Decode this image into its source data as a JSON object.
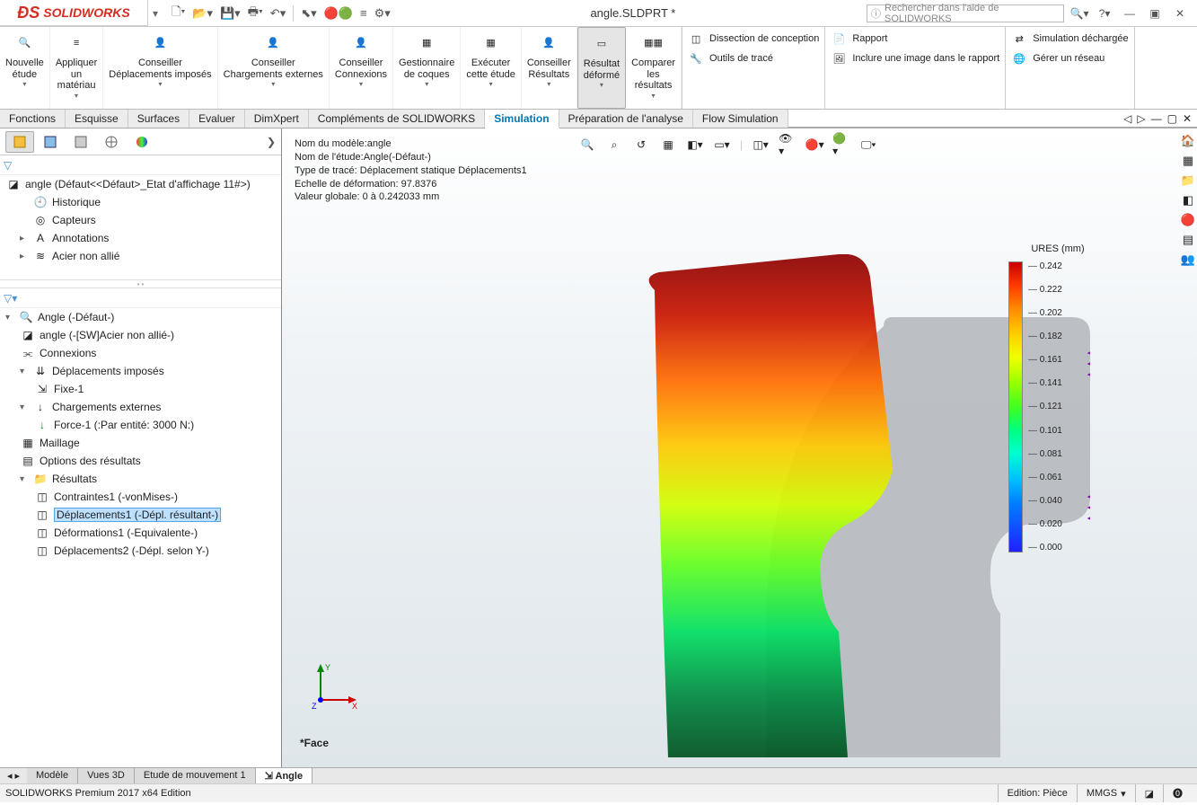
{
  "app": {
    "name": "SOLIDWORKS",
    "title": "angle.SLDPRT *",
    "search_placeholder": "Rechercher dans l'aide de SOLIDWORKS"
  },
  "qat": [
    "new",
    "open",
    "save",
    "print",
    "undo",
    "select",
    "rebuild",
    "options",
    "settings"
  ],
  "ribbon": {
    "buttons": [
      {
        "key": "nouvelle-etude",
        "label": "Nouvelle\nétude"
      },
      {
        "key": "appliquer-materiau",
        "label": "Appliquer\nun\nmatériau"
      },
      {
        "key": "conseiller-depl",
        "label": "Conseiller\nDéplacements imposés"
      },
      {
        "key": "conseiller-charg",
        "label": "Conseiller\nChargements externes"
      },
      {
        "key": "conseiller-conn",
        "label": "Conseiller\nConnexions"
      },
      {
        "key": "gest-coques",
        "label": "Gestionnaire\nde coques"
      },
      {
        "key": "executer",
        "label": "Exécuter\ncette étude"
      },
      {
        "key": "conseiller-res",
        "label": "Conseiller\nRésultats"
      },
      {
        "key": "resultat-deforme",
        "label": "Résultat\ndéformé",
        "active": true
      },
      {
        "key": "comparer",
        "label": "Comparer\nles\nrésultats"
      }
    ],
    "col1": [
      {
        "k": "dissection",
        "label": "Dissection de conception"
      },
      {
        "k": "outils-trace",
        "label": "Outils de tracé"
      }
    ],
    "col2": [
      {
        "k": "rapport",
        "label": "Rapport"
      },
      {
        "k": "image-rapport",
        "label": "Inclure une image dans le rapport"
      }
    ],
    "col3": [
      {
        "k": "sim-dechargee",
        "label": "Simulation déchargée"
      },
      {
        "k": "gerer-reseau",
        "label": "Gérer un réseau"
      }
    ]
  },
  "tabs": [
    "Fonctions",
    "Esquisse",
    "Surfaces",
    "Evaluer",
    "DimXpert",
    "Compléments de SOLIDWORKS",
    "Simulation",
    "Préparation de l'analyse",
    "Flow Simulation"
  ],
  "active_tab": "Simulation",
  "feature_tree": {
    "root": "angle  (Défaut<<Défaut>_Etat d'affichage 11#>)",
    "items": [
      "Historique",
      "Capteurs",
      "Annotations",
      "Acier non allié"
    ]
  },
  "sim_tree": {
    "root": "Angle (-Défaut-)",
    "material": "angle (-[SW]Acier non allié-)",
    "conn": "Connexions",
    "depl": "Déplacements imposés",
    "depl_items": [
      "Fixe-1"
    ],
    "charg": "Chargements externes",
    "charg_items": [
      "Force-1 (:Par entité: 3000 N:)"
    ],
    "mesh": "Maillage",
    "opts": "Options des résultats",
    "res": "Résultats",
    "res_items": [
      "Contraintes1 (-vonMises-)",
      "Déplacements1 (-Dépl. résultant-)",
      "Déformations1 (-Equivalente-)",
      "Déplacements2 (-Dépl. selon Y-)"
    ],
    "selected": "Déplacements1 (-Dépl. résultant-)"
  },
  "viewport_info": [
    "Nom du modèle:angle",
    "Nom de l'étude:Angle(-Défaut-)",
    "Type de tracé: Déplacement statique Déplacements1",
    "Echelle de déformation: 97.8376",
    "Valeur globale: 0 à 0.242033 mm"
  ],
  "legend": {
    "title": "URES (mm)",
    "values": [
      "0.242",
      "0.222",
      "0.202",
      "0.182",
      "0.161",
      "0.141",
      "0.121",
      "0.101",
      "0.081",
      "0.061",
      "0.040",
      "0.020",
      "0.000"
    ]
  },
  "face_label": "*Face",
  "doc_tabs": [
    "Modèle",
    "Vues 3D",
    "Etude de mouvement 1",
    "Angle"
  ],
  "active_doc_tab": "Angle",
  "statusbar": {
    "left": "SOLIDWORKS Premium 2017 x64 Edition",
    "edition": "Edition: Pièce",
    "units": "MMGS"
  },
  "chart_data": {
    "type": "heatmap",
    "title": "URES (mm)",
    "min": 0.0,
    "max": 0.242,
    "ticks": [
      0.242,
      0.222,
      0.202,
      0.182,
      0.161,
      0.141,
      0.121,
      0.101,
      0.081,
      0.061,
      0.04,
      0.02,
      0.0
    ],
    "colormap": "rainbow",
    "note": "Static displacement result plot; colors map displacement magnitude (mm). Deformation scale 97.8376."
  }
}
